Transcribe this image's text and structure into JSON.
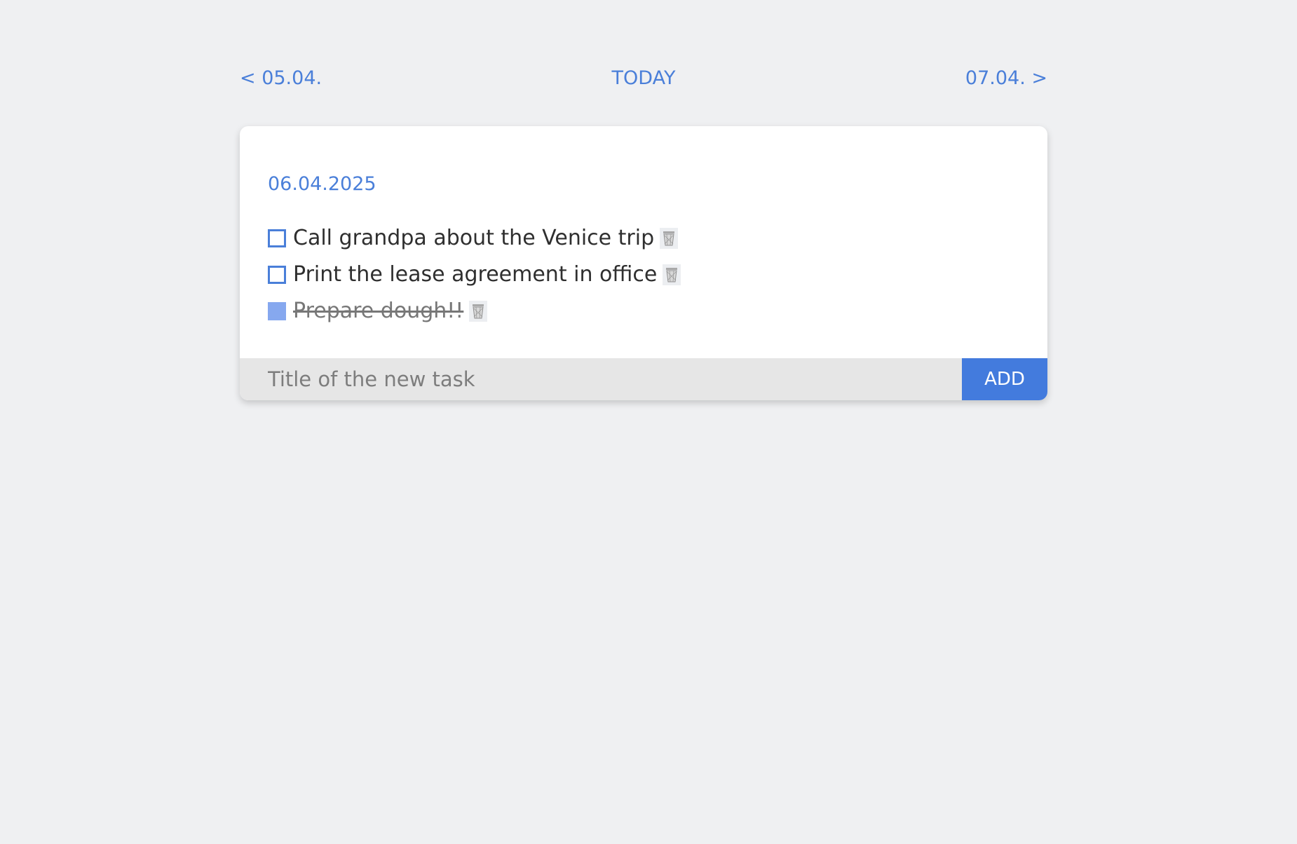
{
  "navigation": {
    "previous_label": "< 05.04.",
    "today_label": "TODAY",
    "next_label": "07.04. >"
  },
  "card": {
    "date": "06.04.2025",
    "tasks": [
      {
        "title": "Call grandpa about the Venice trip",
        "completed": false
      },
      {
        "title": "Print the lease agreement in office",
        "completed": false
      },
      {
        "title": "Prepare dough!!",
        "completed": true
      }
    ],
    "new_task": {
      "value": "",
      "placeholder": "Title of the new task"
    },
    "add_label": "ADD"
  },
  "icons": {
    "delete": "trash-bin-icon"
  },
  "colors": {
    "accent": "#437bdd",
    "link": "#4a7fd9",
    "checked_box": "#86a8ef",
    "background": "#eff0f2",
    "input_background": "#e6e6e6"
  }
}
